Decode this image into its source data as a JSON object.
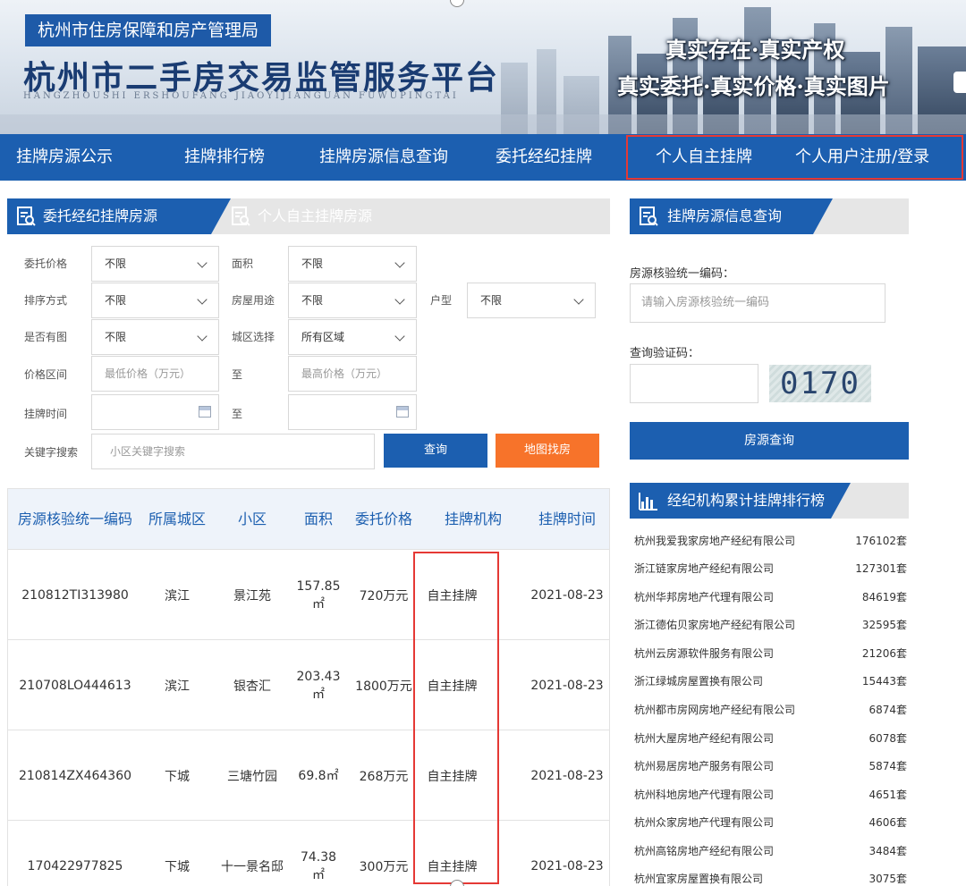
{
  "header": {
    "agency": "杭州市住房保障和房产管理局",
    "platform_title": "杭州市二手房交易监管服务平台",
    "platform_pinyin": "HANGZHOUSHI ERSHOUFANG JIAOYIJIANGUAN FUWUPINGTAI",
    "slogan_1": "真实存在·真实产权",
    "slogan_2": "真实委托·真实价格·真实图片"
  },
  "nav": {
    "items": [
      "挂牌房源公示",
      "挂牌排行榜",
      "挂牌房源信息查询",
      "委托经纪挂牌",
      "个人自主挂牌",
      "个人用户注册/登录"
    ]
  },
  "tabs": {
    "active": "委托经纪挂牌房源",
    "inactive": "个人自主挂牌房源"
  },
  "filters": {
    "price_label": "委托价格",
    "price_value": "不限",
    "area_label": "面积",
    "area_value": "不限",
    "sort_label": "排序方式",
    "sort_value": "不限",
    "usage_label": "房屋用途",
    "usage_value": "不限",
    "layout_label": "户型",
    "layout_value": "不限",
    "has_image_label": "是否有图",
    "has_image_value": "不限",
    "district_label": "城区选择",
    "district_value": "所有区域",
    "price_range_label": "价格区间",
    "price_min_placeholder": "最低价格（万元）",
    "to_label": "至",
    "price_max_placeholder": "最高价格（万元）",
    "listing_time_label": "挂牌时间",
    "keyword_label": "关键字搜索",
    "keyword_placeholder": "小区关键字搜索",
    "query_button": "查询",
    "map_button": "地图找房"
  },
  "table": {
    "headers": [
      "房源核验统一编码",
      "所属城区",
      "小区",
      "面积",
      "委托价格",
      "挂牌机构",
      "挂牌时间"
    ],
    "rows": [
      {
        "code": "210812TI313980",
        "district": "滨江",
        "community": "景江苑",
        "area_num": "157.85",
        "area_unit": "㎡",
        "price": "720万元",
        "agency": "自主挂牌",
        "date": "2021-08-23"
      },
      {
        "code": "210708LO444613",
        "district": "滨江",
        "community": "银杏汇",
        "area_num": "203.43",
        "area_unit": "㎡",
        "price": "1800万元",
        "agency": "自主挂牌",
        "date": "2021-08-23"
      },
      {
        "code": "210814ZX464360",
        "district": "下城",
        "community": "三塘竹园",
        "area_num": "69.8㎡",
        "area_unit": "",
        "price": "268万元",
        "agency": "自主挂牌",
        "date": "2021-08-23"
      },
      {
        "code": "170422977825",
        "district": "下城",
        "community": "十一景名邸",
        "area_num": "74.38",
        "area_unit": "㎡",
        "price": "300万元",
        "agency": "自主挂牌",
        "date": "2021-08-23"
      }
    ]
  },
  "search_panel": {
    "title": "挂牌房源信息查询",
    "code_label": "房源核验统一编码：",
    "code_placeholder": "请输入房源核验统一编码",
    "captcha_label": "查询验证码：",
    "captcha_value": "0170",
    "submit": "房源查询"
  },
  "ranking": {
    "title": "经纪机构累计挂牌排行榜",
    "items": [
      {
        "name": "杭州我爱我家房地产经纪有限公司",
        "count": "176102套"
      },
      {
        "name": "浙江链家房地产经纪有限公司",
        "count": "127301套"
      },
      {
        "name": "杭州华邦房地产代理有限公司",
        "count": "84619套"
      },
      {
        "name": "浙江德佑贝家房地产经纪有限公司",
        "count": "32595套"
      },
      {
        "name": "杭州云房源软件服务有限公司",
        "count": "21206套"
      },
      {
        "name": "浙江绿城房屋置换有限公司",
        "count": "15443套"
      },
      {
        "name": "杭州都市房网房地产经纪有限公司",
        "count": "6874套"
      },
      {
        "name": "杭州大屋房地产经纪有限公司",
        "count": "6078套"
      },
      {
        "name": "杭州易居房地产服务有限公司",
        "count": "5874套"
      },
      {
        "name": "杭州科地房地产代理有限公司",
        "count": "4651套"
      },
      {
        "name": "杭州众家房地产代理有限公司",
        "count": "4606套"
      },
      {
        "name": "杭州高铭房地产经纪有限公司",
        "count": "3484套"
      },
      {
        "name": "杭州宜家房屋置换有限公司",
        "count": "3075套"
      }
    ]
  },
  "colors": {
    "primary": "#1c5fb0",
    "accent_orange": "#f7732a",
    "highlight_red": "#e53935"
  }
}
